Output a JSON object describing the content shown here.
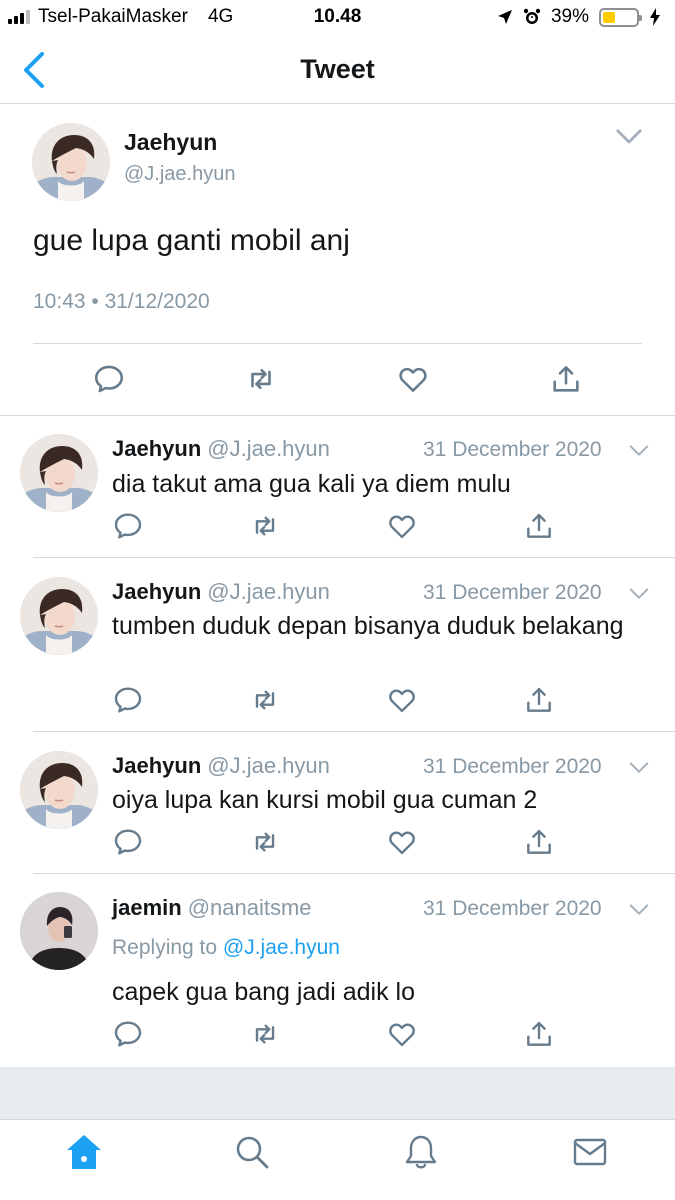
{
  "status_bar": {
    "carrier": "Tsel-PakaiMasker",
    "network": "4G",
    "time": "10.48",
    "battery_percent": "39%",
    "battery_level": 0.39
  },
  "nav": {
    "title": "Tweet",
    "back_icon": "chevron-left-icon"
  },
  "main_tweet": {
    "name": "Jaehyun",
    "handle": "@J.jae.hyun",
    "text": "gue lupa ganti mobil anj",
    "timestamp": "10:43 • 31/12/2020"
  },
  "replies": [
    {
      "name": "Jaehyun",
      "handle": "@J.jae.hyun",
      "date": "31 December 2020",
      "text": "dia takut ama gua kali ya diem mulu"
    },
    {
      "name": "Jaehyun",
      "handle": "@J.jae.hyun",
      "date": "31 December 2020",
      "text": "tumben duduk depan bisanya duduk belakang"
    },
    {
      "name": "Jaehyun",
      "handle": "@J.jae.hyun",
      "date": "31 December 2020",
      "text": "oiya lupa kan kursi mobil gua cuman 2"
    },
    {
      "name": "jaemin",
      "handle": "@nanaitsme",
      "date": "31 December 2020",
      "replying_prefix": "Replying to",
      "replying_to": "@J.jae.hyun",
      "text": "capek gua bang jadi adik lo"
    }
  ],
  "tab_bar": [
    "home-icon",
    "search-icon",
    "notifications-icon",
    "messages-icon"
  ],
  "colors": {
    "accent": "#1da1f2",
    "secondary_text": "#8899a6",
    "divider": "#d6d9dc",
    "band": "#e6ecf0"
  }
}
